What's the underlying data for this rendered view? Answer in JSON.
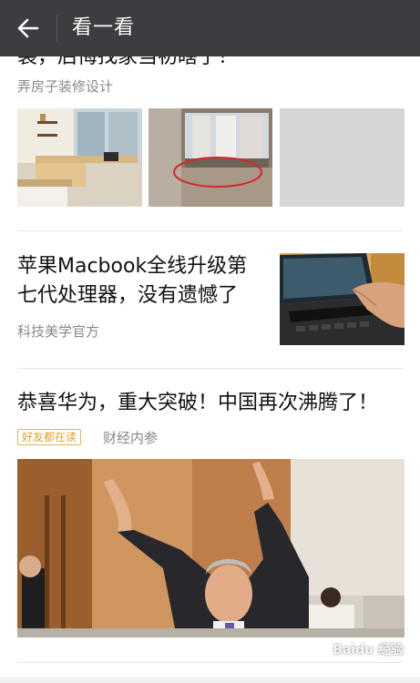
{
  "header": {
    "title": "看一看",
    "back_icon": "arrow-left-icon"
  },
  "articles": [
    {
      "title_partial": "装，后悔找家当初瞎了！",
      "source": "弄房子装修设计"
    },
    {
      "title": "苹果Macbook全线升级第七代处理器，没有遗憾了",
      "title_line1": "苹果Macbook全线升级第",
      "title_line2": "七代处理器，没有遗憾了",
      "source": "科技美学官方"
    },
    {
      "title": "恭喜华为，重大突破！中国再次沸腾了！",
      "badge": "好友都在读",
      "source": "财经内参"
    }
  ],
  "watermark": "Baidu 经验",
  "colors": {
    "header_bg": "#3b3d40",
    "badge": "#e1a12a"
  }
}
